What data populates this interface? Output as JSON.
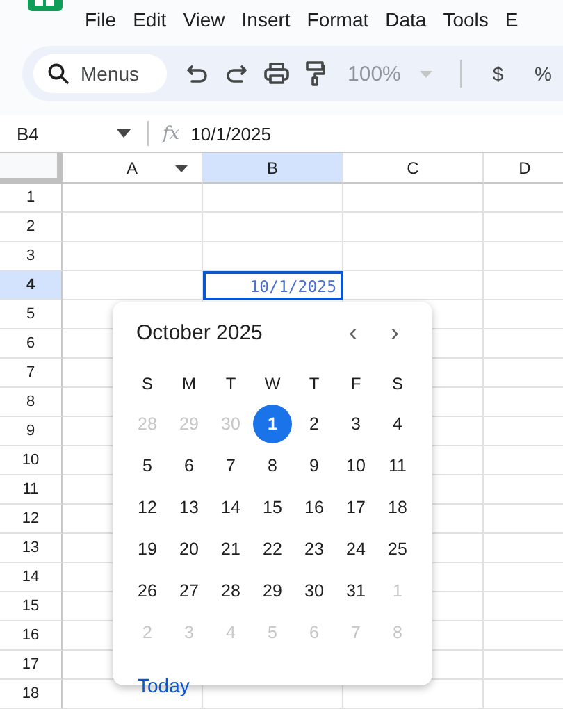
{
  "menu_bar": [
    "File",
    "Edit",
    "View",
    "Insert",
    "Format",
    "Data",
    "Tools",
    "E"
  ],
  "toolbar": {
    "search": {
      "placeholder": "Menus"
    },
    "zoom": {
      "value": "100%",
      "disabled": true
    },
    "currency": "$",
    "percent": "%"
  },
  "formula_bar": {
    "cell_ref": "B4",
    "function_label": "fx",
    "value": "10/1/2025"
  },
  "columns": [
    {
      "label": "A",
      "selected": false,
      "filter": true
    },
    {
      "label": "B",
      "selected": true,
      "filter": false
    },
    {
      "label": "C",
      "selected": false,
      "filter": false
    },
    {
      "label": "D",
      "selected": false,
      "filter": false
    }
  ],
  "rows": [
    {
      "label": "1",
      "selected": false
    },
    {
      "label": "2",
      "selected": false
    },
    {
      "label": "3",
      "selected": false
    },
    {
      "label": "4",
      "selected": true,
      "selected_cell": {
        "value": "10/1/2025",
        "selected": true
      }
    },
    {
      "label": "5",
      "selected": false
    },
    {
      "label": "6",
      "selected": false
    },
    {
      "label": "7",
      "selected": false
    },
    {
      "label": "8",
      "selected": false
    },
    {
      "label": "9",
      "selected": false
    },
    {
      "label": "10",
      "selected": false
    },
    {
      "label": "11",
      "selected": false
    },
    {
      "label": "12",
      "selected": false
    },
    {
      "label": "13",
      "selected": false
    },
    {
      "label": "14",
      "selected": false
    },
    {
      "label": "15",
      "selected": false
    },
    {
      "label": "16",
      "selected": false
    },
    {
      "label": "17",
      "selected": false
    },
    {
      "label": "18",
      "selected": false
    }
  ],
  "date_picker": {
    "month_title": "October 2025",
    "prev": "‹",
    "next": "›",
    "weekdays": [
      "S",
      "M",
      "T",
      "W",
      "T",
      "F",
      "S"
    ],
    "days": [
      {
        "label": "28",
        "outside": true,
        "selected": false
      },
      {
        "label": "29",
        "outside": true,
        "selected": false
      },
      {
        "label": "30",
        "outside": true,
        "selected": false
      },
      {
        "label": "1",
        "outside": false,
        "selected": true
      },
      {
        "label": "2",
        "outside": false,
        "selected": false
      },
      {
        "label": "3",
        "outside": false,
        "selected": false
      },
      {
        "label": "4",
        "outside": false,
        "selected": false
      },
      {
        "label": "5",
        "outside": false,
        "selected": false
      },
      {
        "label": "6",
        "outside": false,
        "selected": false
      },
      {
        "label": "7",
        "outside": false,
        "selected": false
      },
      {
        "label": "8",
        "outside": false,
        "selected": false
      },
      {
        "label": "9",
        "outside": false,
        "selected": false
      },
      {
        "label": "10",
        "outside": false,
        "selected": false
      },
      {
        "label": "11",
        "outside": false,
        "selected": false
      },
      {
        "label": "12",
        "outside": false,
        "selected": false
      },
      {
        "label": "13",
        "outside": false,
        "selected": false
      },
      {
        "label": "14",
        "outside": false,
        "selected": false
      },
      {
        "label": "15",
        "outside": false,
        "selected": false
      },
      {
        "label": "16",
        "outside": false,
        "selected": false
      },
      {
        "label": "17",
        "outside": false,
        "selected": false
      },
      {
        "label": "18",
        "outside": false,
        "selected": false
      },
      {
        "label": "19",
        "outside": false,
        "selected": false
      },
      {
        "label": "20",
        "outside": false,
        "selected": false
      },
      {
        "label": "21",
        "outside": false,
        "selected": false
      },
      {
        "label": "22",
        "outside": false,
        "selected": false
      },
      {
        "label": "23",
        "outside": false,
        "selected": false
      },
      {
        "label": "24",
        "outside": false,
        "selected": false
      },
      {
        "label": "25",
        "outside": false,
        "selected": false
      },
      {
        "label": "26",
        "outside": false,
        "selected": false
      },
      {
        "label": "27",
        "outside": false,
        "selected": false
      },
      {
        "label": "28",
        "outside": false,
        "selected": false
      },
      {
        "label": "29",
        "outside": false,
        "selected": false
      },
      {
        "label": "30",
        "outside": false,
        "selected": false
      },
      {
        "label": "31",
        "outside": false,
        "selected": false
      },
      {
        "label": "1",
        "outside": true,
        "selected": false
      },
      {
        "label": "2",
        "outside": true,
        "selected": false
      },
      {
        "label": "3",
        "outside": true,
        "selected": false
      },
      {
        "label": "4",
        "outside": true,
        "selected": false
      },
      {
        "label": "5",
        "outside": true,
        "selected": false
      },
      {
        "label": "6",
        "outside": true,
        "selected": false
      },
      {
        "label": "7",
        "outside": true,
        "selected": false
      },
      {
        "label": "8",
        "outside": true,
        "selected": false
      }
    ],
    "today_button": "Today"
  }
}
